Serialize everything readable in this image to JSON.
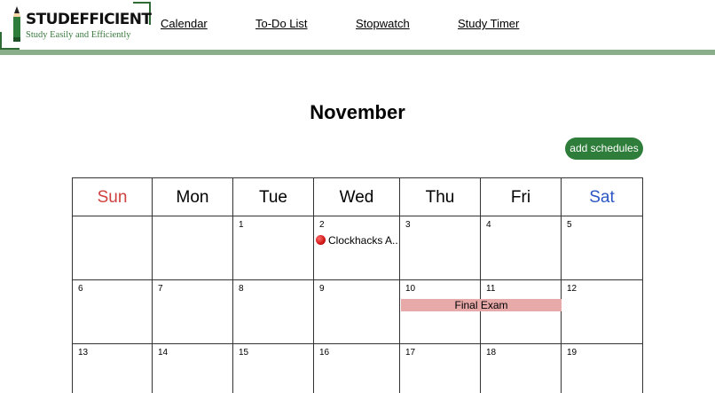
{
  "brand": {
    "name": "STUDEFFICIENT",
    "tagline": "Study Easily and Efficiently"
  },
  "nav": [
    {
      "label": "Calendar"
    },
    {
      "label": "To-Do List"
    },
    {
      "label": "Stopwatch"
    },
    {
      "label": "Study Timer"
    }
  ],
  "calendar": {
    "month": "November",
    "add_button": "add schedules",
    "days": [
      "Sun",
      "Mon",
      "Tue",
      "Wed",
      "Thu",
      "Fri",
      "Sat"
    ],
    "weeks": [
      [
        "",
        "",
        "1",
        "2",
        "3",
        "4",
        "5"
      ],
      [
        "6",
        "7",
        "8",
        "9",
        "10",
        "11",
        "12"
      ],
      [
        "13",
        "14",
        "15",
        "16",
        "17",
        "18",
        "19"
      ]
    ],
    "events": {
      "clockhacks": "Clockhacks A..",
      "final_exam": "Final Exam"
    }
  },
  "colors": {
    "accent_green": "#2e7d3a",
    "header_rule": "#8aae89",
    "sunday": "#d0413d",
    "saturday": "#2b57c4",
    "event_bar": "#e8a9a9"
  }
}
